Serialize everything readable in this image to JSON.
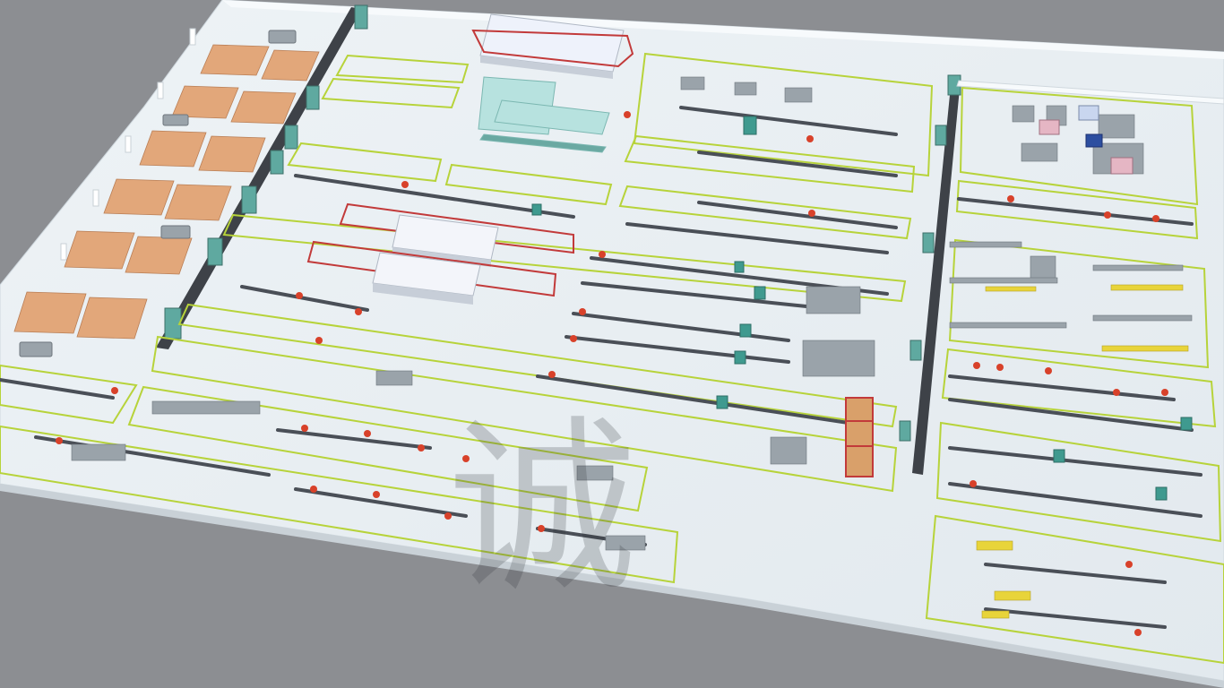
{
  "scene": {
    "kind": "3D isometric factory floor layout render",
    "colors": {
      "background": "#8c8e92",
      "floor": "#e8eef2",
      "floor_shade": "#d9e1e7",
      "wall": "#f4f7f9",
      "zone_line": "#b7d33a",
      "robot": "#d8412a",
      "machine_teal": "#3f9a8f",
      "machine_dark": "#4a4f57",
      "pallet": "#e2a77a",
      "rack_yellow": "#e8d43a",
      "conveyor_red": "#c23a3a"
    },
    "icons": [
      "forklift-icon",
      "robot-arm-icon",
      "pallet-icon",
      "conveyor-icon",
      "elevator-icon"
    ]
  },
  "watermark": {
    "glyph": "诚"
  }
}
